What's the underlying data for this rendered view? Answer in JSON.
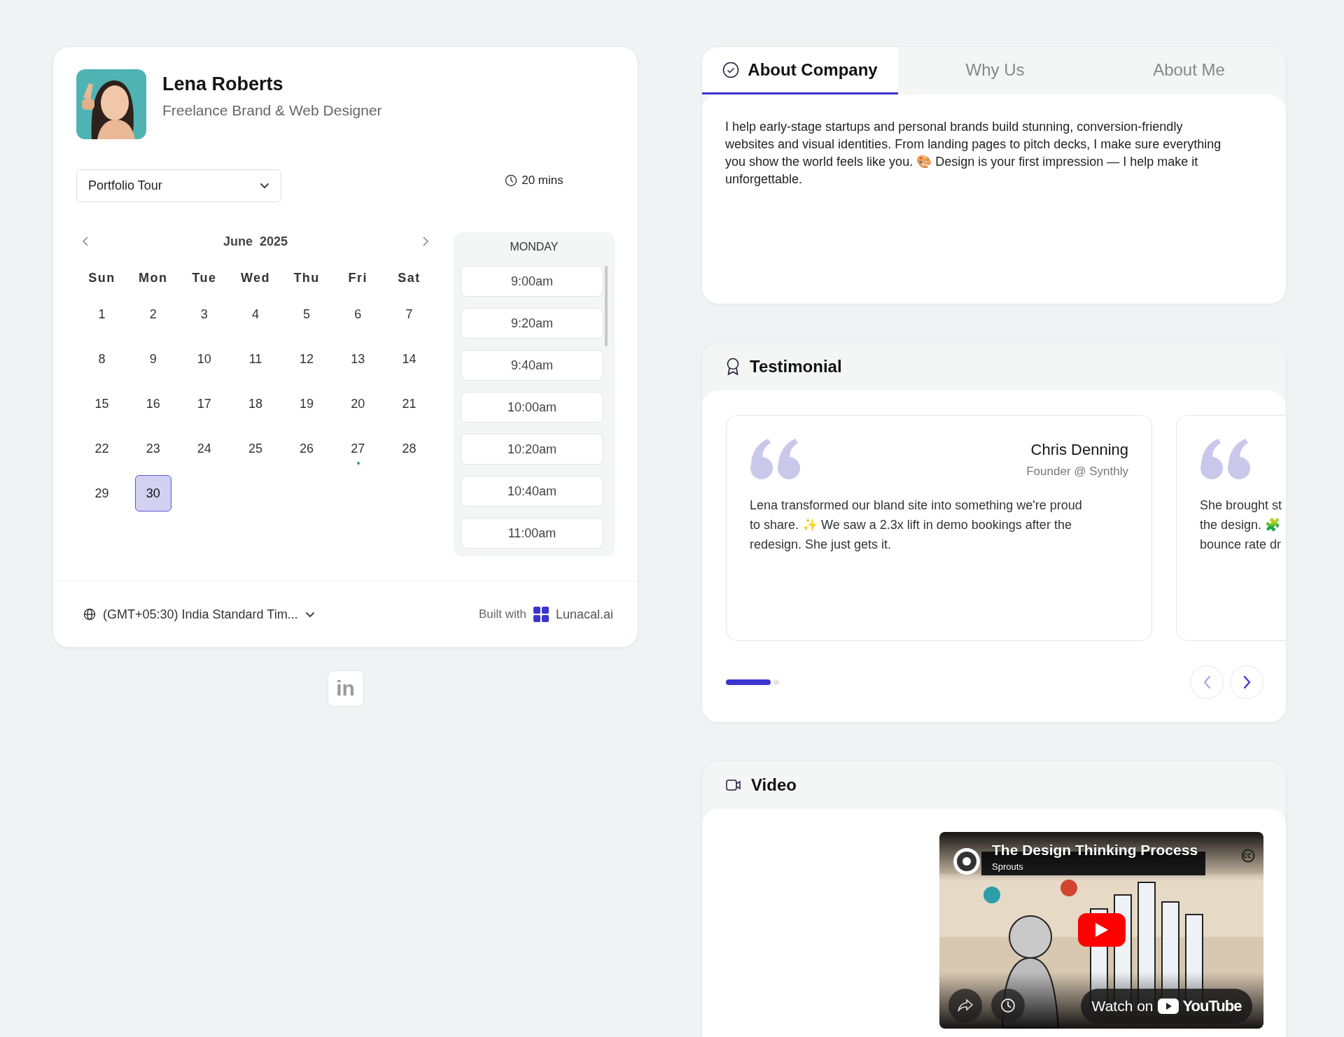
{
  "profile": {
    "name": "Lena Roberts",
    "role": "Freelance Brand & Web Designer"
  },
  "event_select": {
    "value": "Portfolio Tour"
  },
  "duration": "20 mins",
  "calendar": {
    "month": "June",
    "year": "2025",
    "weekdays": [
      "Sun",
      "Mon",
      "Tue",
      "Wed",
      "Thu",
      "Fri",
      "Sat"
    ],
    "days": [
      {
        "label": "1",
        "selected": false,
        "marked": false
      },
      {
        "label": "2",
        "selected": false,
        "marked": false
      },
      {
        "label": "3",
        "selected": false,
        "marked": false
      },
      {
        "label": "4",
        "selected": false,
        "marked": false
      },
      {
        "label": "5",
        "selected": false,
        "marked": false
      },
      {
        "label": "6",
        "selected": false,
        "marked": false
      },
      {
        "label": "7",
        "selected": false,
        "marked": false
      },
      {
        "label": "8",
        "selected": false,
        "marked": false
      },
      {
        "label": "9",
        "selected": false,
        "marked": false
      },
      {
        "label": "10",
        "selected": false,
        "marked": false
      },
      {
        "label": "11",
        "selected": false,
        "marked": false
      },
      {
        "label": "12",
        "selected": false,
        "marked": false
      },
      {
        "label": "13",
        "selected": false,
        "marked": false
      },
      {
        "label": "14",
        "selected": false,
        "marked": false
      },
      {
        "label": "15",
        "selected": false,
        "marked": false
      },
      {
        "label": "16",
        "selected": false,
        "marked": false
      },
      {
        "label": "17",
        "selected": false,
        "marked": false
      },
      {
        "label": "18",
        "selected": false,
        "marked": false
      },
      {
        "label": "19",
        "selected": false,
        "marked": false
      },
      {
        "label": "20",
        "selected": false,
        "marked": false
      },
      {
        "label": "21",
        "selected": false,
        "marked": false
      },
      {
        "label": "22",
        "selected": false,
        "marked": false
      },
      {
        "label": "23",
        "selected": false,
        "marked": false
      },
      {
        "label": "24",
        "selected": false,
        "marked": false
      },
      {
        "label": "25",
        "selected": false,
        "marked": false
      },
      {
        "label": "26",
        "selected": false,
        "marked": false
      },
      {
        "label": "27",
        "selected": false,
        "marked": true
      },
      {
        "label": "28",
        "selected": false,
        "marked": false
      },
      {
        "label": "29",
        "selected": false,
        "marked": false
      },
      {
        "label": "30",
        "selected": true,
        "marked": false
      }
    ]
  },
  "time_slots": {
    "day": "MONDAY",
    "slots": [
      "9:00am",
      "9:20am",
      "9:40am",
      "10:00am",
      "10:20am",
      "10:40am",
      "11:00am"
    ]
  },
  "footer": {
    "timezone": "(GMT+05:30) India Standard Tim...",
    "built_with": "Built with",
    "brand": "Lunacal.ai"
  },
  "social": [
    {
      "kind": "linkedin",
      "label": "in"
    }
  ],
  "about": {
    "tabs": [
      {
        "label": "About Company",
        "selected": true
      },
      {
        "label": "Why Us",
        "selected": false
      },
      {
        "label": "About Me",
        "selected": false
      }
    ],
    "text": "I help early-stage startups and personal brands build stunning, conversion-friendly websites and visual identities. From landing pages to pitch decks, I make sure everything you show the world feels like you. 🎨 Design is your first impression — I help make it unforgettable."
  },
  "testimonials": {
    "title": "Testimonial",
    "items": [
      {
        "name": "Chris Denning",
        "role": "Founder @ Synthly",
        "lines": [
          "Lena transformed our bland site into something we're proud",
          "to share. ✨ We saw a 2.3x lift in demo bookings after the",
          "redesign. She just gets it."
        ]
      },
      {
        "lines": [
          "She brought st",
          "the design. 🧩",
          "bounce rate dr"
        ]
      }
    ],
    "pages": [
      {
        "selected": true
      },
      {
        "selected": false
      }
    ],
    "nav": [
      {
        "kind": "prev",
        "disabled": true
      },
      {
        "kind": "next",
        "disabled": false
      }
    ]
  },
  "video": {
    "title": "Video",
    "player": {
      "title": "The Design Thinking Process",
      "channel": "Sprouts",
      "watch_on": "Watch on",
      "platform": "YouTube"
    }
  }
}
